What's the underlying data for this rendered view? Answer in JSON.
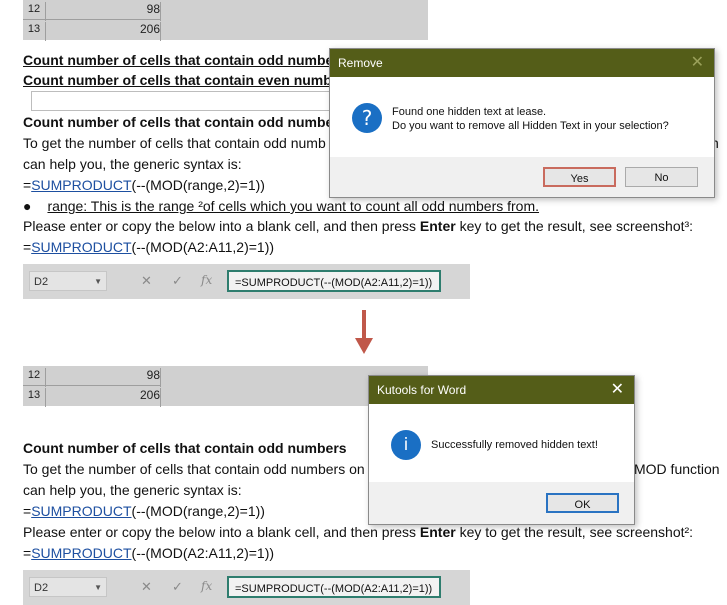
{
  "top": {
    "excel": {
      "rows": [
        {
          "num": "12",
          "val": "98"
        },
        {
          "num": "13",
          "val": "206"
        }
      ]
    },
    "heading_odd": "Count number of cells that contain odd numbe",
    "heading_even": "Count number of cells that contain even numb",
    "heading_odd2": "Count number of cells that contain odd numbe",
    "para1_a": "To get the number of cells that contain odd numb",
    "para1_tail": "n",
    "para1_b": "can help you, the generic syntax is:",
    "formula1_prefix": "=",
    "formula1_fn": "SUMPRODUCT",
    "formula1_rest": "(--(MOD(range,2)=1))",
    "bullet": "●",
    "bullet_text": "range: This is the range  ²of cells which you want to count all odd numbers from.",
    "para2_a": "Please enter or copy the below into a blank cell, and then press ",
    "para2_key": "Enter",
    "para2_b": " key to get the result, see screenshot³:",
    "formula2_prefix": "=",
    "formula2_fn": "SUMPRODUCT",
    "formula2_rest": "(--(MOD(A2:A11,2)=1))",
    "formula_bar": {
      "cell": "D2",
      "fx": "fx",
      "cancel": "✕",
      "enter": "✓",
      "formula": "=SUMPRODUCT(--(MOD(A2:A11,2)=1))"
    }
  },
  "remove_dialog": {
    "title": "Remove",
    "close": "✕",
    "icon": "?",
    "line1": "Found one hidden text at lease.",
    "line2": "Do you want to remove all Hidden Text in your selection?",
    "yes": "Yes",
    "no": "No"
  },
  "bottom": {
    "excel": {
      "rows": [
        {
          "num": "12",
          "val": "98"
        },
        {
          "num": "13",
          "val": "206"
        }
      ]
    },
    "heading": "Count number of cells that contain odd numbers",
    "para1_a": "To get the number of cells that contain odd numbers on",
    "para1_tail": "MOD function",
    "para1_b": "can help you, the generic syntax is:",
    "formula1_prefix": "=",
    "formula1_fn": "SUMPRODUCT",
    "formula1_rest": "(--(MOD(range,2)=1))",
    "para2_a": "Please enter or copy the below into a blank cell, and then press ",
    "para2_key": "Enter",
    "para2_b": " key to get the result, see screenshot²:",
    "formula2_prefix": "=",
    "formula2_fn": "SUMPRODUCT",
    "formula2_rest": "(--(MOD(A2:A11,2)=1))",
    "formula_bar": {
      "cell": "D2",
      "fx": "fx",
      "cancel": "✕",
      "enter": "✓",
      "formula": "=SUMPRODUCT(--(MOD(A2:A11,2)=1))"
    }
  },
  "kutools_dialog": {
    "title": "Kutools for Word",
    "close": "✕",
    "icon": "i",
    "message": "Successfully removed hidden text!",
    "ok": "OK"
  },
  "colors": {
    "title_bar": "#545d18",
    "formula_border": "#2e7d6e",
    "arrow": "#c0584a",
    "info_blue": "#1a6fc4"
  }
}
